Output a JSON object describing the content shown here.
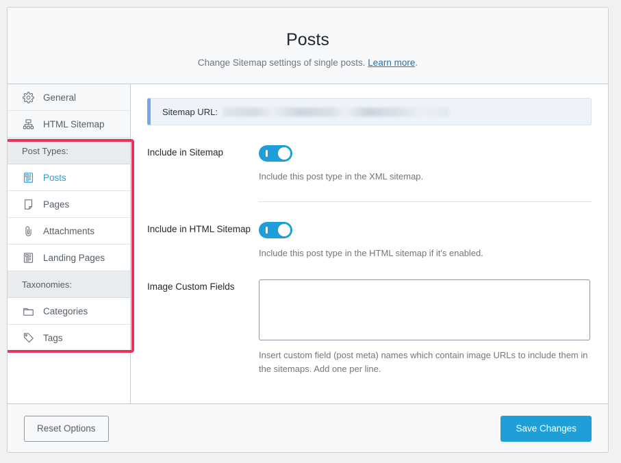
{
  "header": {
    "title": "Posts",
    "subtitle_text": "Change Sitemap settings of single posts. ",
    "link_label": "Learn more",
    "subtitle_tail": "."
  },
  "sidebar": {
    "top_items": [
      {
        "label": "General",
        "icon": "gear-icon"
      },
      {
        "label": "HTML Sitemap",
        "icon": "sitemap-icon"
      }
    ],
    "groups": [
      {
        "heading": "Post Types:",
        "items": [
          {
            "label": "Posts",
            "icon": "article-icon",
            "active": true
          },
          {
            "label": "Pages",
            "icon": "page-icon",
            "active": false
          },
          {
            "label": "Attachments",
            "icon": "paperclip-icon",
            "active": false
          },
          {
            "label": "Landing Pages",
            "icon": "article-icon",
            "active": false
          }
        ]
      },
      {
        "heading": "Taxonomies:",
        "items": [
          {
            "label": "Categories",
            "icon": "folder-icon",
            "active": false
          },
          {
            "label": "Tags",
            "icon": "tag-icon",
            "active": false
          }
        ]
      }
    ],
    "highlight_color": "#e8345c"
  },
  "main": {
    "notice": {
      "label": "Sitemap URL:",
      "value": ""
    },
    "include_sitemap": {
      "label": "Include in Sitemap",
      "toggle_state": "on",
      "help": "Include this post type in the XML sitemap."
    },
    "include_html_sitemap": {
      "label": "Include in HTML Sitemap",
      "toggle_state": "on",
      "help": "Include this post type in the HTML sitemap if it's enabled."
    },
    "image_custom_fields": {
      "label": "Image Custom Fields",
      "value": "",
      "placeholder": "",
      "help": "Insert custom field (post meta) names which contain image URLs to include them in the sitemaps. Add one per line."
    }
  },
  "footer": {
    "reset_label": "Reset Options",
    "save_label": "Save Changes"
  },
  "colors": {
    "accent": "#1f9fd8",
    "link": "#2271b1",
    "highlight": "#e8345c"
  }
}
